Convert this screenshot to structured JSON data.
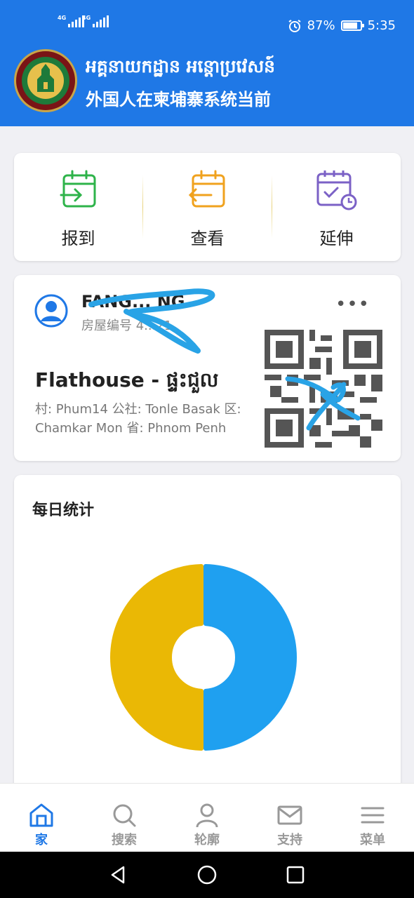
{
  "status_bar": {
    "sim1": "4G",
    "sim2": "4G",
    "battery": "87%",
    "battery_level": 0.87,
    "time": "5:35"
  },
  "header": {
    "title_khmer": "អគ្គនាយកដ្ឋាន អន្តោប្រវេសន៍",
    "title_chinese": "外国人在柬埔寨系统当前",
    "logo_icon": "immigration-emblem-icon"
  },
  "actions": [
    {
      "label": "报到",
      "icon": "calendar-checkin-icon",
      "color": "#2eb34a"
    },
    {
      "label": "查看",
      "icon": "calendar-checkout-icon",
      "color": "#f0a21e"
    },
    {
      "label": "延伸",
      "icon": "calendar-extend-icon",
      "color": "#7b61c6"
    }
  ],
  "house_card": {
    "name": "FANG... NG",
    "room_label": "房屋编号 4...21",
    "title": "Flathouse - ផ្ទះជួល",
    "address": "村: Phum14 公社: Tonle Basak 区: Chamkar Mon 省: Phnom Penh",
    "more_label": "•••"
  },
  "stats": {
    "title": "每日统计",
    "chart_data": {
      "type": "pie",
      "categories": [
        "yellow",
        "blue"
      ],
      "values": [
        50,
        50
      ],
      "colors": [
        "#eab805",
        "#1fa0f0"
      ],
      "title": "每日统计"
    }
  },
  "bottom_nav": [
    {
      "label": "家",
      "icon": "home-icon",
      "active": true
    },
    {
      "label": "搜索",
      "icon": "search-icon",
      "active": false
    },
    {
      "label": "轮廓",
      "icon": "profile-icon",
      "active": false
    },
    {
      "label": "支持",
      "icon": "mail-icon",
      "active": false
    },
    {
      "label": "菜单",
      "icon": "menu-icon",
      "active": false
    }
  ],
  "colors": {
    "primary": "#1f78e6",
    "background": "#f0f0f4"
  }
}
